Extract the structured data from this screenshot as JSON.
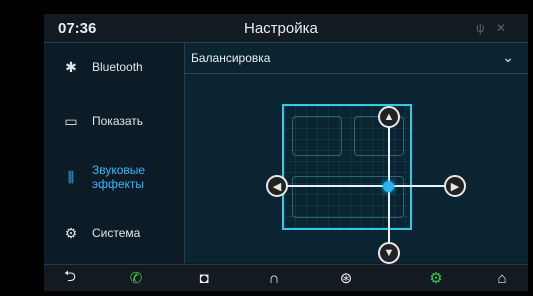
{
  "status": {
    "time": "07:36",
    "title": "Настройка",
    "icons": "ψ ✕"
  },
  "sidebar": {
    "items": [
      {
        "label": "Bluetooth",
        "icon": "bluetooth-icon",
        "glyph": "✱",
        "active": false
      },
      {
        "label": "Показать",
        "icon": "display-icon",
        "glyph": "▭",
        "active": false
      },
      {
        "label": "Звуковые\nэффекты",
        "icon": "equalizer-icon",
        "glyph": "⫼",
        "active": true
      },
      {
        "label": "Система",
        "icon": "gear-icon",
        "glyph": "⚙",
        "active": false
      }
    ]
  },
  "content": {
    "dropdown_label": "Балансировка",
    "dropdown_chevron": "⌄"
  },
  "balance": {
    "arrows": {
      "up": "▲",
      "down": "▼",
      "left": "◀",
      "right": "▶"
    }
  },
  "bottom_nav": [
    {
      "icon": "back-icon",
      "glyph": "⮌",
      "color": "#e8eef2"
    },
    {
      "icon": "phone-icon",
      "glyph": "✆",
      "color": "#35c94a"
    },
    {
      "icon": "camera-icon",
      "glyph": "◘",
      "color": "#e8eef2"
    },
    {
      "icon": "headphones-icon",
      "glyph": "∩",
      "color": "#e8eef2"
    },
    {
      "icon": "steering-wheel-icon",
      "glyph": "⊛",
      "color": "#e8eef2"
    },
    {
      "icon": "settings-icon",
      "glyph": "⚙",
      "color": "#35c94a"
    },
    {
      "icon": "home-icon",
      "glyph": "⌂",
      "color": "#e8eef2"
    }
  ],
  "colors": {
    "accent": "#31b9ff",
    "frame": "#36c9e4",
    "green": "#35c94a"
  }
}
